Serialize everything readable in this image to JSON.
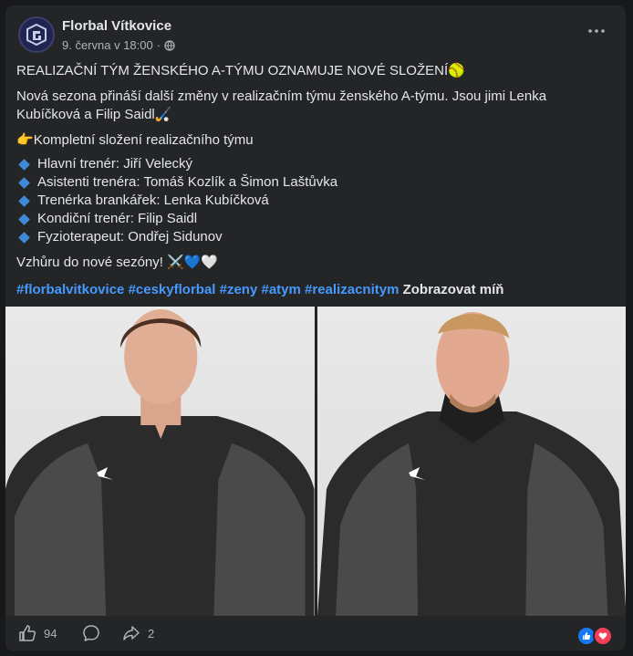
{
  "post": {
    "author": "Florbal Vítkovice",
    "timestamp": "9. června v 18:00",
    "separator": "·",
    "title": "REALIZAČNÍ TÝM ŽENSKÉHO A-TÝMU OZNAMUJE NOVÉ SLOŽENÍ",
    "title_emoji": "🥎",
    "intro_line1": "Nová sezona přináší další změny v realizačním týmu ženského A-týmu. Jsou jimi Lenka",
    "intro_line2": "Kubíčková a Filip Saidl",
    "intro_emoji": "🏑",
    "lead_emoji": "👉",
    "lead": "Kompletní složení realizačního týmu",
    "staff": [
      "Hlavní trenér: Jiří Velecký",
      "Asistenti trenéra: Tomáš Kozlík a Šimon Laštůvka",
      "Trenérka brankářek: Lenka Kubíčková",
      "Kondiční trenér: Filip Saidl",
      "Fyzioterapeut: Ondřej Sidunov"
    ],
    "closing": "Vzhůru do nové sezóny!",
    "closing_emojis": "⚔️💙🤍",
    "hashtags": [
      "#florbalvitkovice",
      "#ceskyflorbal",
      "#zeny",
      "#atym",
      "#realizacnitym"
    ],
    "see_less": "Zobrazovat míň"
  },
  "footer": {
    "likes": "94",
    "shares": "2"
  },
  "colors": {
    "background": "#18191a",
    "card": "#242526",
    "text": "#e4e6eb",
    "secondary": "#b0b3b8",
    "link": "#4599ff",
    "like_blue": "#1877f2",
    "love_red": "#f33e58"
  },
  "icons": {
    "avatar": "club-logo",
    "meta": "globe-icon",
    "menu": "more-icon",
    "like": "thumb-up-icon",
    "comment": "comment-icon",
    "share": "share-icon"
  }
}
